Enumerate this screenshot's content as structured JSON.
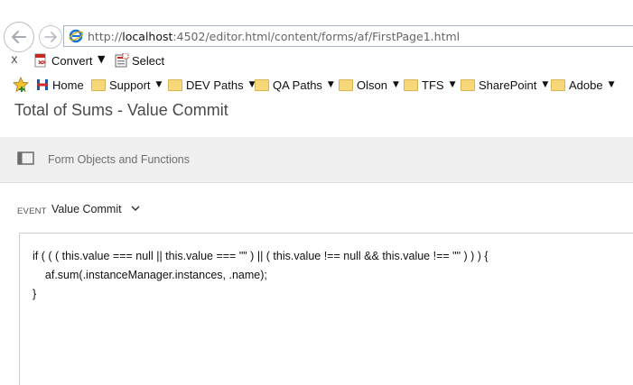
{
  "browser": {
    "address": {
      "prefix": "http://",
      "host": "localhost",
      "rest": ":4502/editor.html/content/forms/af/FirstPage1.html"
    },
    "toolbar": {
      "close_label": "x",
      "convert_label": "Convert",
      "convert_caret": "▼",
      "select_label": "Select"
    },
    "bookmarks": [
      {
        "label": "Home",
        "caret": ""
      },
      {
        "label": "Support",
        "caret": "▼"
      },
      {
        "label": "DEV Paths",
        "caret": "▼"
      },
      {
        "label": "QA Paths",
        "caret": "▼"
      },
      {
        "label": "Olson",
        "caret": "▼"
      },
      {
        "label": "TFS",
        "caret": "▼"
      },
      {
        "label": "SharePoint",
        "caret": "▼"
      },
      {
        "label": "Adobe",
        "caret": "▼"
      }
    ]
  },
  "editor": {
    "title": "Total of Sums - Value Commit",
    "objects_panel_label": "Form Objects and Functions",
    "event_label": "EVENT",
    "event_value": "Value Commit",
    "code_lines": [
      "if ( ( ( this.value === null || this.value === \"\" ) || ( this.value !== null && this.value !== \"\" ) ) ) {",
      "    af.sum(.instanceManager.instances, .name);",
      "}"
    ]
  }
}
